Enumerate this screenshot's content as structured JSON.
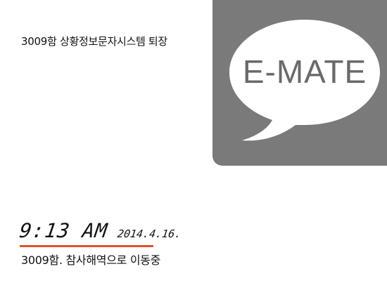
{
  "notification": {
    "message": "3009함 상황정보문자시스템 퇴장"
  },
  "app_tile": {
    "logo_text": "E-MATE",
    "tile_color": "#7a7a7a",
    "bubble_color": "#ffffff",
    "icon": "speech-bubble-icon"
  },
  "status": {
    "time": "9:13 AM",
    "date": "2014.4.16.",
    "underline_color": "#e0542a",
    "message": "3009함. 참사해역으로 이동중"
  }
}
